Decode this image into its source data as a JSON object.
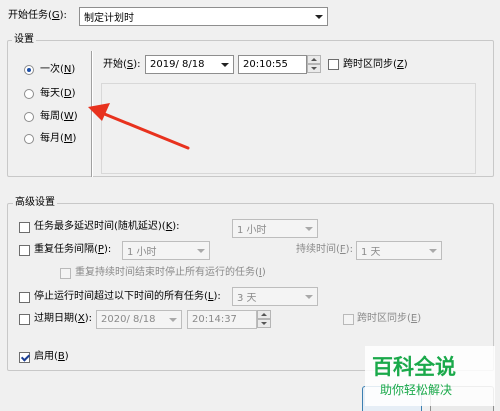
{
  "start_task": {
    "label_text": "开始任务(",
    "label_key": "G",
    "label_tail": "):",
    "value": "制定计划时"
  },
  "settings": {
    "title": "设置",
    "radios": [
      {
        "text": "一次(",
        "key": "N",
        "tail": ")",
        "checked": true
      },
      {
        "text": "每天(",
        "key": "D",
        "tail": ")",
        "checked": false
      },
      {
        "text": "每周(",
        "key": "W",
        "tail": ")",
        "checked": false
      },
      {
        "text": "每月(",
        "key": "M",
        "tail": ")",
        "checked": false
      }
    ],
    "start_label_text": "开始(",
    "start_label_key": "S",
    "start_label_tail": "):",
    "date": "2019/  8/18",
    "time": "20:10:55",
    "sync_tz_text": "跨时区同步(",
    "sync_tz_key": "Z",
    "sync_tz_tail": ")"
  },
  "advanced": {
    "title": "高级设置",
    "max_delay": {
      "text": "任务最多延迟时间(随机延迟)(",
      "key": "K",
      "tail": "):",
      "value": "1 小时"
    },
    "repeat": {
      "text": "重复任务间隔(",
      "key": "P",
      "tail": "):",
      "value": "1 小时",
      "duration_text": "持续时间(",
      "duration_key": "F",
      "duration_tail": "):",
      "duration_value": "1 天"
    },
    "stop_at_end": {
      "text": "重复持续时间结束时停止所有运行的任务(",
      "key": "I",
      "tail": ")"
    },
    "stop_longer": {
      "text": "停止运行时间超过以下时间的所有任务(",
      "key": "L",
      "tail": "):",
      "value": "3 天"
    },
    "expire": {
      "text": "过期日期(",
      "key": "X",
      "tail": "):",
      "date": "2020/  8/18",
      "time": "20:14:37",
      "sync_text": "跨时区同步(",
      "sync_key": "E",
      "sync_tail": ")"
    },
    "enabled": {
      "text": "启用(",
      "key": "B",
      "tail": ")"
    }
  },
  "watermark": {
    "main": "百科全说",
    "sub": "助你轻松解决"
  },
  "colors": {
    "arrow": "#e8321e",
    "watermark": "#1aa94a"
  }
}
